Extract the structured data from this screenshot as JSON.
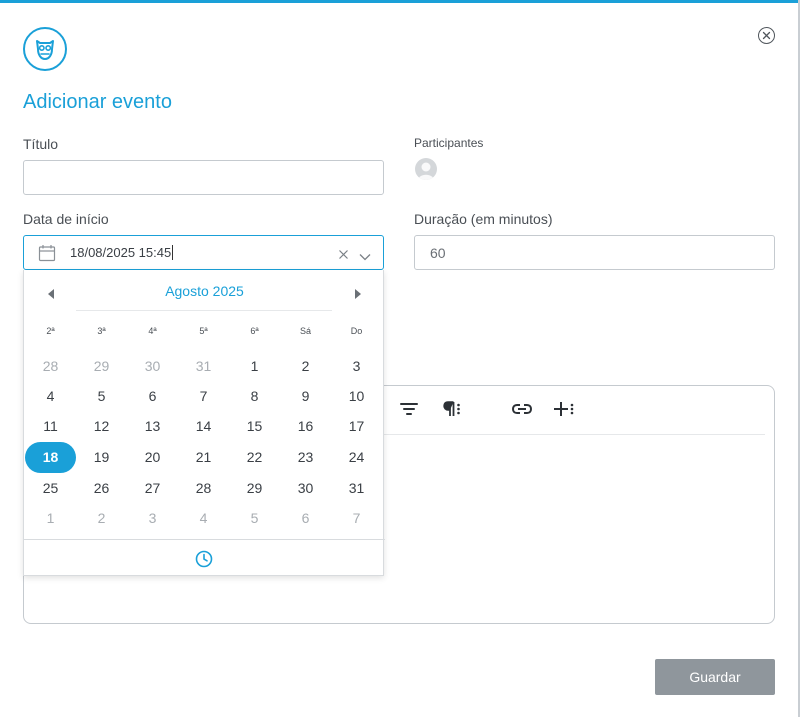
{
  "dialog": {
    "title": "Adicionar evento",
    "accent_color": "#1aa0d8",
    "close_icon": "close-circle-icon",
    "logo_icon": "owl-logo-icon"
  },
  "form": {
    "title_label": "Título",
    "title_value": "",
    "participants_label": "Participantes",
    "start_date_label": "Data de início",
    "start_date_value": "18/08/2025 15:45",
    "duration_label": "Duração (em minutos)",
    "duration_value": "60"
  },
  "datepicker": {
    "month_label": "Agosto 2025",
    "weekdays": [
      "2ª",
      "3ª",
      "4ª",
      "5ª",
      "6ª",
      "Sá",
      "Do"
    ],
    "weeks": [
      [
        {
          "d": "28",
          "m": true
        },
        {
          "d": "29",
          "m": true
        },
        {
          "d": "30",
          "m": true
        },
        {
          "d": "31",
          "m": true
        },
        {
          "d": "1"
        },
        {
          "d": "2"
        },
        {
          "d": "3"
        }
      ],
      [
        {
          "d": "4"
        },
        {
          "d": "5"
        },
        {
          "d": "6"
        },
        {
          "d": "7"
        },
        {
          "d": "8"
        },
        {
          "d": "9"
        },
        {
          "d": "10"
        }
      ],
      [
        {
          "d": "11"
        },
        {
          "d": "12"
        },
        {
          "d": "13"
        },
        {
          "d": "14"
        },
        {
          "d": "15"
        },
        {
          "d": "16"
        },
        {
          "d": "17"
        }
      ],
      [
        {
          "d": "18",
          "sel": true
        },
        {
          "d": "19"
        },
        {
          "d": "20"
        },
        {
          "d": "21"
        },
        {
          "d": "22"
        },
        {
          "d": "23"
        },
        {
          "d": "24"
        }
      ],
      [
        {
          "d": "25"
        },
        {
          "d": "26"
        },
        {
          "d": "27"
        },
        {
          "d": "28"
        },
        {
          "d": "29"
        },
        {
          "d": "30"
        },
        {
          "d": "31"
        }
      ],
      [
        {
          "d": "1",
          "m": true
        },
        {
          "d": "2",
          "m": true
        },
        {
          "d": "3",
          "m": true
        },
        {
          "d": "4",
          "m": true
        },
        {
          "d": "5",
          "m": true
        },
        {
          "d": "6",
          "m": true
        },
        {
          "d": "7",
          "m": true
        }
      ]
    ]
  },
  "editor": {
    "toolbar_icons": [
      "text-align-icon",
      "paragraph-options-icon",
      "link-icon",
      "insert-options-icon"
    ]
  },
  "actions": {
    "save_label": "Guardar",
    "save_color": "#8f969c"
  }
}
